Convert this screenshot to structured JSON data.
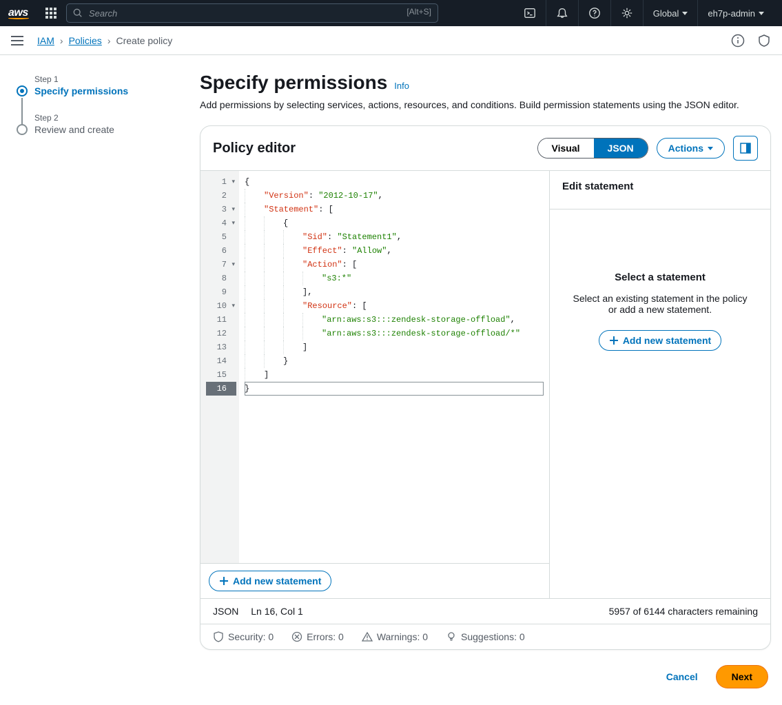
{
  "topnav": {
    "logo": "aws",
    "search_placeholder": "Search",
    "search_hint": "[Alt+S]",
    "region": "Global",
    "account": "eh7p-admin"
  },
  "breadcrumb": {
    "root": "IAM",
    "parent": "Policies",
    "current": "Create policy"
  },
  "steps": [
    {
      "label": "Step 1",
      "title": "Specify permissions",
      "active": true
    },
    {
      "label": "Step 2",
      "title": "Review and create",
      "active": false
    }
  ],
  "page": {
    "title": "Specify permissions",
    "info": "Info",
    "desc": "Add permissions by selecting services, actions, resources, and conditions. Build permission statements using the JSON editor."
  },
  "editor": {
    "title": "Policy editor",
    "tab_visual": "Visual",
    "tab_json": "JSON",
    "actions": "Actions",
    "add_statement": "Add new statement"
  },
  "code": {
    "lines": [
      {
        "n": 1,
        "fold": true,
        "tokens": [
          {
            "t": "punc",
            "v": "{"
          }
        ]
      },
      {
        "n": 2,
        "fold": false,
        "tokens": [
          {
            "t": "pad",
            "v": 1
          },
          {
            "t": "key",
            "v": "\"Version\""
          },
          {
            "t": "punc",
            "v": ": "
          },
          {
            "t": "str",
            "v": "\"2012-10-17\""
          },
          {
            "t": "punc",
            "v": ","
          }
        ]
      },
      {
        "n": 3,
        "fold": true,
        "tokens": [
          {
            "t": "pad",
            "v": 1
          },
          {
            "t": "key",
            "v": "\"Statement\""
          },
          {
            "t": "punc",
            "v": ": ["
          }
        ]
      },
      {
        "n": 4,
        "fold": true,
        "tokens": [
          {
            "t": "pad",
            "v": 2
          },
          {
            "t": "punc",
            "v": "{"
          }
        ]
      },
      {
        "n": 5,
        "fold": false,
        "tokens": [
          {
            "t": "pad",
            "v": 3
          },
          {
            "t": "key",
            "v": "\"Sid\""
          },
          {
            "t": "punc",
            "v": ": "
          },
          {
            "t": "str",
            "v": "\"Statement1\""
          },
          {
            "t": "punc",
            "v": ","
          }
        ]
      },
      {
        "n": 6,
        "fold": false,
        "tokens": [
          {
            "t": "pad",
            "v": 3
          },
          {
            "t": "key",
            "v": "\"Effect\""
          },
          {
            "t": "punc",
            "v": ": "
          },
          {
            "t": "str",
            "v": "\"Allow\""
          },
          {
            "t": "punc",
            "v": ","
          }
        ]
      },
      {
        "n": 7,
        "fold": true,
        "tokens": [
          {
            "t": "pad",
            "v": 3
          },
          {
            "t": "key",
            "v": "\"Action\""
          },
          {
            "t": "punc",
            "v": ": ["
          }
        ]
      },
      {
        "n": 8,
        "fold": false,
        "tokens": [
          {
            "t": "pad",
            "v": 4
          },
          {
            "t": "str",
            "v": "\"s3:*\""
          }
        ]
      },
      {
        "n": 9,
        "fold": false,
        "tokens": [
          {
            "t": "pad",
            "v": 3
          },
          {
            "t": "punc",
            "v": "],"
          }
        ]
      },
      {
        "n": 10,
        "fold": true,
        "tokens": [
          {
            "t": "pad",
            "v": 3
          },
          {
            "t": "key",
            "v": "\"Resource\""
          },
          {
            "t": "punc",
            "v": ": ["
          }
        ]
      },
      {
        "n": 11,
        "fold": false,
        "tokens": [
          {
            "t": "pad",
            "v": 4
          },
          {
            "t": "str",
            "v": "\"arn:aws:s3:::zendesk-storage-offload\""
          },
          {
            "t": "punc",
            "v": ","
          }
        ]
      },
      {
        "n": 12,
        "fold": false,
        "tokens": [
          {
            "t": "pad",
            "v": 4
          },
          {
            "t": "str",
            "v": "\"arn:aws:s3:::zendesk-storage-offload/*\""
          }
        ]
      },
      {
        "n": 13,
        "fold": false,
        "tokens": [
          {
            "t": "pad",
            "v": 3
          },
          {
            "t": "punc",
            "v": "]"
          }
        ]
      },
      {
        "n": 14,
        "fold": false,
        "tokens": [
          {
            "t": "pad",
            "v": 2
          },
          {
            "t": "punc",
            "v": "}"
          }
        ]
      },
      {
        "n": 15,
        "fold": false,
        "tokens": [
          {
            "t": "pad",
            "v": 1
          },
          {
            "t": "punc",
            "v": "]"
          }
        ]
      },
      {
        "n": 16,
        "fold": false,
        "hl": true,
        "tokens": [
          {
            "t": "punc",
            "v": "}"
          }
        ]
      }
    ]
  },
  "side": {
    "title": "Edit statement",
    "empty_title": "Select a statement",
    "empty_desc": "Select an existing statement in the policy or add a new statement.",
    "add": "Add new statement"
  },
  "status": {
    "mode": "JSON",
    "pos": "Ln 16, Col 1",
    "chars": "5957 of 6144 characters remaining"
  },
  "lint": {
    "security": "Security: 0",
    "errors": "Errors: 0",
    "warnings": "Warnings: 0",
    "suggestions": "Suggestions: 0"
  },
  "footer": {
    "cancel": "Cancel",
    "next": "Next"
  }
}
